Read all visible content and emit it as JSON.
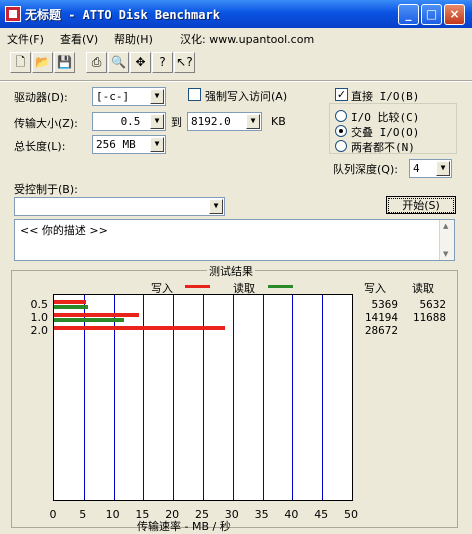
{
  "window": {
    "title": "无标题 - ATTO Disk Benchmark",
    "btn_min": "_",
    "btn_max": "□",
    "btn_close": "×"
  },
  "menu": {
    "file": "文件(F)",
    "view": "查看(V)",
    "help": "帮助(H)",
    "localization": "汉化: www.upantool.com"
  },
  "toolbar": [
    "new-icon",
    "open-icon",
    "save-icon",
    "print-icon",
    "print-preview-icon",
    "move-icon",
    "help-icon",
    "context-help-icon"
  ],
  "form": {
    "drive_label": "驱动器(D):",
    "drive_value": "[-c-]",
    "force_write_label": "强制写入访问(A)",
    "direct_io_label": "直接 I/O(B)",
    "direct_io_checked": "✓",
    "transfer_label": "传输大小(Z):",
    "transfer_from": "0.5",
    "to_label": "到",
    "transfer_to": "8192.0",
    "kb_label": "KB",
    "length_label": "总长度(L):",
    "length_value": "256 MB",
    "io_compare_label": "I/O 比较(C)",
    "overlap_label": "交叠 I/O(O)",
    "neither_label": "两者都不(N)",
    "queue_label": "队列深度(Q):",
    "queue_value": "4",
    "controlled_label": "受控制于(B):",
    "controlled_value": "",
    "start_button": "开始(S)",
    "description": "<<  你的描述  >>"
  },
  "results": {
    "title": "测试结果",
    "write_legend": "写入",
    "read_legend": "读取",
    "col_write": "写入",
    "col_read": "读取",
    "rows": [
      {
        "size": "0.5",
        "write": "5369",
        "read": "5632"
      },
      {
        "size": "1.0",
        "write": "14194",
        "read": "11688"
      },
      {
        "size": "2.0",
        "write": "28672",
        "read": ""
      }
    ],
    "xlabel": "传输速率 - MB / 秒",
    "xticks": [
      "0",
      "5",
      "10",
      "15",
      "20",
      "25",
      "30",
      "35",
      "40",
      "45",
      "50"
    ]
  },
  "chart_data": {
    "type": "bar",
    "orientation": "horizontal",
    "title": "测试结果",
    "categories": [
      "0.5",
      "1.0",
      "2.0"
    ],
    "series": [
      {
        "name": "写入",
        "color": "#e8231b",
        "values": [
          5.369,
          14.194,
          28.672
        ]
      },
      {
        "name": "读取",
        "color": "#2a8a2a",
        "values": [
          5.632,
          11.688,
          null
        ]
      }
    ],
    "xlabel": "传输速率 - MB / 秒",
    "xlim": [
      0,
      50
    ],
    "grid": true
  }
}
